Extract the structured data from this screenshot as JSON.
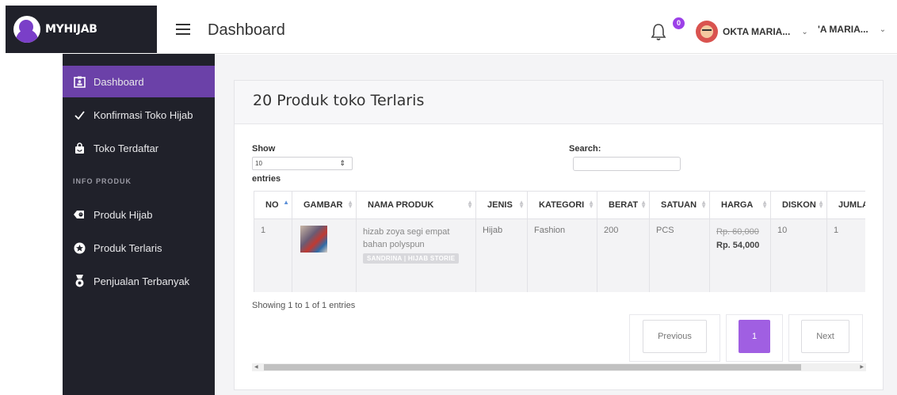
{
  "brand": {
    "name": "MYHIJAB"
  },
  "header": {
    "title": "Dashboard",
    "notification_count": "0",
    "user_name": "OKTA MARIA...",
    "user_name_2": "'A MARIA..."
  },
  "sidebar": {
    "items": [
      {
        "label": "Dashboard",
        "icon": "dashboard-icon",
        "active": true
      },
      {
        "label": "Konfirmasi Toko Hijab",
        "icon": "check-icon"
      },
      {
        "label": "Toko Terdaftar",
        "icon": "shopping-bag-icon"
      }
    ],
    "heading": "INFO PRODUK",
    "items2": [
      {
        "label": "Produk Hijab",
        "icon": "product-icon"
      },
      {
        "label": "Produk Terlaris",
        "icon": "star-icon"
      },
      {
        "label": "Penjualan Terbanyak",
        "icon": "medal-icon"
      }
    ],
    "accent_color": "#6b41a8"
  },
  "panel": {
    "title": "20 Produk toko Terlaris",
    "show_label": "Show",
    "length_value": "10",
    "entries_label": "entries",
    "search_label": "Search:",
    "search_value": ""
  },
  "table": {
    "columns": [
      "NO",
      "GAMBAR",
      "NAMA PRODUK",
      "JENIS",
      "KATEGORI",
      "BERAT",
      "SATUAN",
      "HARGA",
      "DISKON",
      "JUMLA"
    ],
    "rows": [
      {
        "no": "1",
        "product_name": "hizab zoya segi empat bahan polyspun",
        "store_badge": "SANDRINA | HIJAB STORIE",
        "jenis": "Hijab",
        "kategori": "Fashion",
        "berat": "200",
        "satuan": "PCS",
        "harga_old": "Rp. 60,000",
        "harga_new": "Rp. 54,000",
        "diskon": "10",
        "jumlah": "1"
      }
    ]
  },
  "info": "Showing 1 to 1 of 1 entries",
  "pagination": {
    "previous": "Previous",
    "current": "1",
    "next": "Next",
    "accent_color": "#a05fe2"
  }
}
